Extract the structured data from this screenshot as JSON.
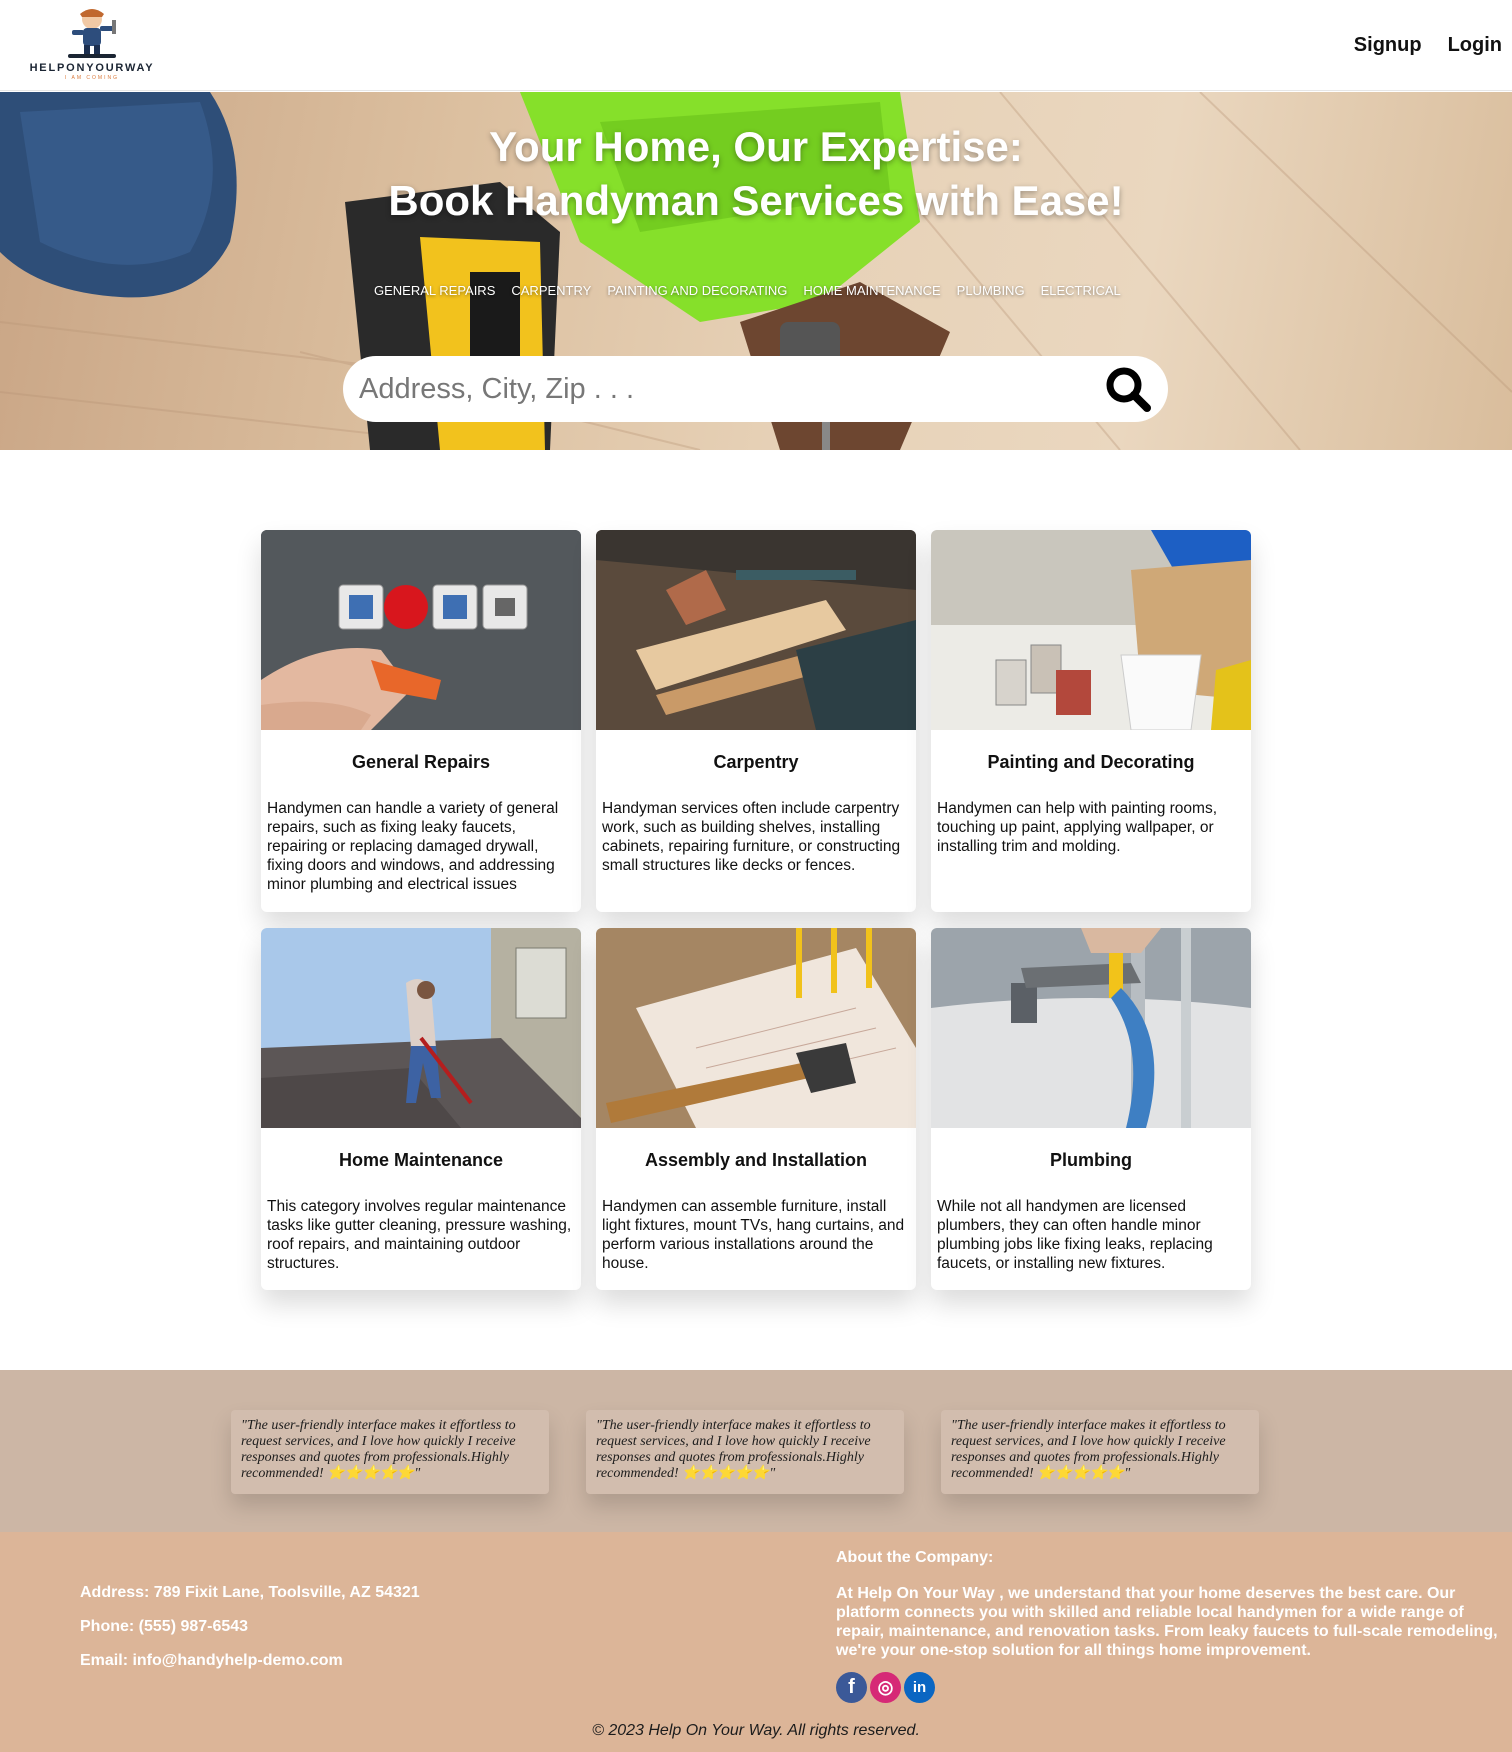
{
  "header": {
    "logo_text": "HELPONYOURWAY",
    "logo_tagline": "I AM COMING",
    "nav": {
      "signup": "Signup",
      "login": "Login"
    }
  },
  "hero": {
    "title_line1": "Your Home, Our Expertise:",
    "title_line2": "Book Handyman Services with Ease!",
    "categories": [
      "GENERAL REPAIRS",
      "CARPENTRY",
      "PAINTING AND DECORATING",
      "HOME MAINTENANCE",
      "PLUMBING",
      "ELECTRICAL"
    ],
    "search": {
      "placeholder": "Address, City, Zip . . .",
      "value": "",
      "icon": "search-icon"
    }
  },
  "services": [
    {
      "title": "General Repairs",
      "description": "Handymen can handle a variety of general repairs, such as fixing leaky faucets, repairing or replacing damaged drywall, fixing doors and windows, and addressing minor plumbing and electrical issues"
    },
    {
      "title": "Carpentry",
      "description": "Handyman services often include carpentry work, such as building shelves, installing cabinets, repairing furniture, or constructing small structures like decks or fences."
    },
    {
      "title": "Painting and Decorating",
      "description": "Handymen can help with painting rooms, touching up paint, applying wallpaper, or installing trim and molding."
    },
    {
      "title": "Home Maintenance",
      "description": "This category involves regular maintenance tasks like gutter cleaning, pressure washing, roof repairs, and maintaining outdoor structures."
    },
    {
      "title": "Assembly and Installation",
      "description": "Handymen can assemble furniture, install light fixtures, mount TVs, hang curtains, and perform various installations around the house."
    },
    {
      "title": "Plumbing",
      "description": "While not all handymen are licensed plumbers, they can often handle minor plumbing jobs like fixing leaks, replacing faucets, or installing new fixtures."
    }
  ],
  "testimonials": [
    {
      "text": "\"The user-friendly interface makes it effortless to request services, and I love how quickly I receive responses and quotes from professionals.Highly recommended! ⭐⭐⭐⭐⭐\""
    },
    {
      "text": "\"The user-friendly interface makes it effortless to request services, and I love how quickly I receive responses and quotes from professionals.Highly recommended! ⭐⭐⭐⭐⭐\""
    },
    {
      "text": "\"The user-friendly interface makes it effortless to request services, and I love how quickly I receive responses and quotes from professionals.Highly recommended! ⭐⭐⭐⭐⭐\""
    }
  ],
  "footer": {
    "address": "Address: 789 Fixit Lane, Toolsville, AZ 54321",
    "phone": "Phone: (555) 987-6543",
    "email": "Email: info@handyhelp-demo.com",
    "about_heading": "About the Company:",
    "about_text": "At Help On Your Way , we understand that your home deserves the best care. Our platform connects you with skilled and reliable local handymen for a wide range of repair, maintenance, and renovation tasks. From leaky faucets to full-scale remodeling, we're your one-stop solution for all things home improvement.",
    "socials": [
      {
        "icon": "facebook-icon",
        "glyph": "f",
        "color": "#3b5998"
      },
      {
        "icon": "instagram-icon",
        "glyph": "◎",
        "color": "#d62976"
      },
      {
        "icon": "linkedin-icon",
        "glyph": "in",
        "color": "#0a66c2"
      }
    ],
    "copyright": "© 2023 Help On Your Way. All rights reserved."
  }
}
